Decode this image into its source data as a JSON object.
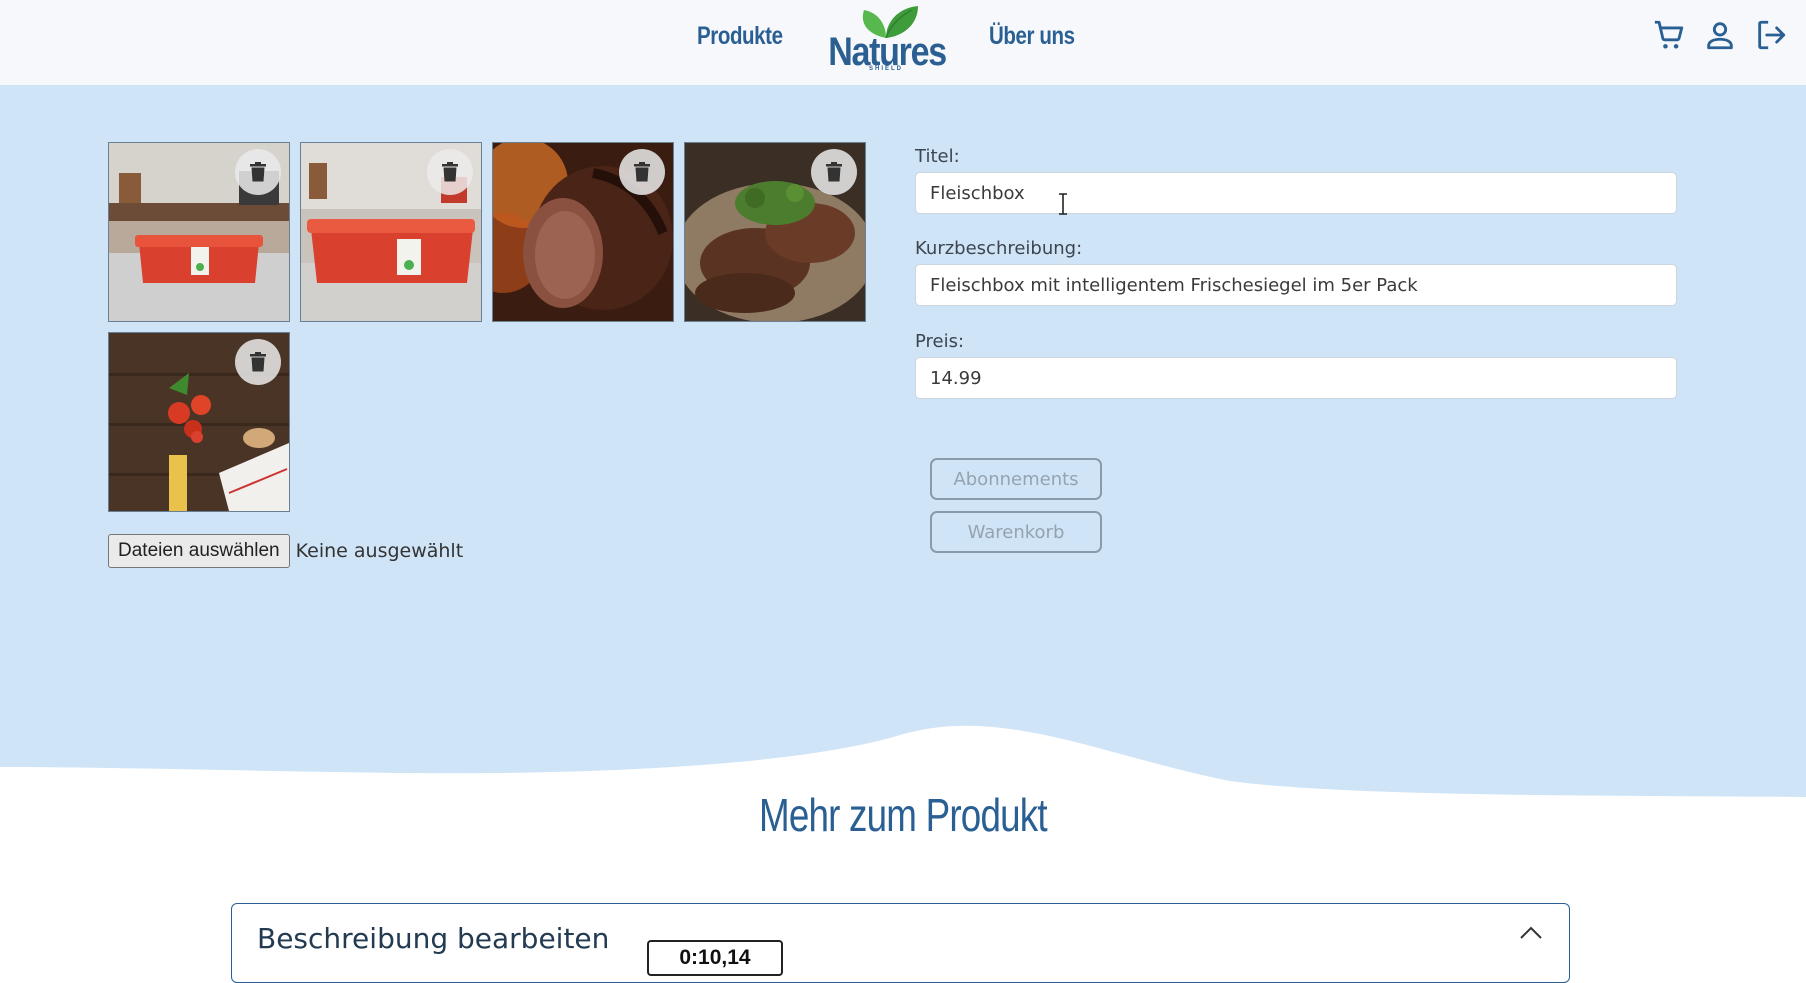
{
  "header": {
    "nav_products": "Produkte",
    "nav_about": "Über uns",
    "logo_text": "Natures",
    "logo_subtext": "SHIELD",
    "icons": [
      "cart-icon",
      "user-icon",
      "logout-icon"
    ]
  },
  "gallery": {
    "images": [
      {
        "subject": "red food box on kitchen counter"
      },
      {
        "subject": "red food box on kitchen counter close-up"
      },
      {
        "subject": "roasted meat joint"
      },
      {
        "subject": "grilled steaks with herbs"
      },
      {
        "subject": "tomatoes, pasta and spoon on wooden table"
      }
    ],
    "file_button": "Dateien auswählen",
    "file_status": "Keine ausgewählt"
  },
  "form": {
    "title_label": "Titel:",
    "title_value": "Fleischbox",
    "short_desc_label": "Kurzbeschreibung:",
    "short_desc_value": "Fleischbox mit intelligentem Frischesiegel im 5er Pack",
    "price_label": "Preis:",
    "price_value": "14.99",
    "subscriptions_button": "Abonnements",
    "cart_button": "Warenkorb"
  },
  "more_section": {
    "title": "Mehr zum Produkt",
    "accordion_title": "Beschreibung bearbeiten"
  },
  "overlay": {
    "timer": "0:10,14"
  },
  "colors": {
    "brand_blue": "#2a5f93",
    "section_bg": "#cfe4f7",
    "header_bg": "#f6f8fb",
    "leaf_green": "#4caf50"
  }
}
